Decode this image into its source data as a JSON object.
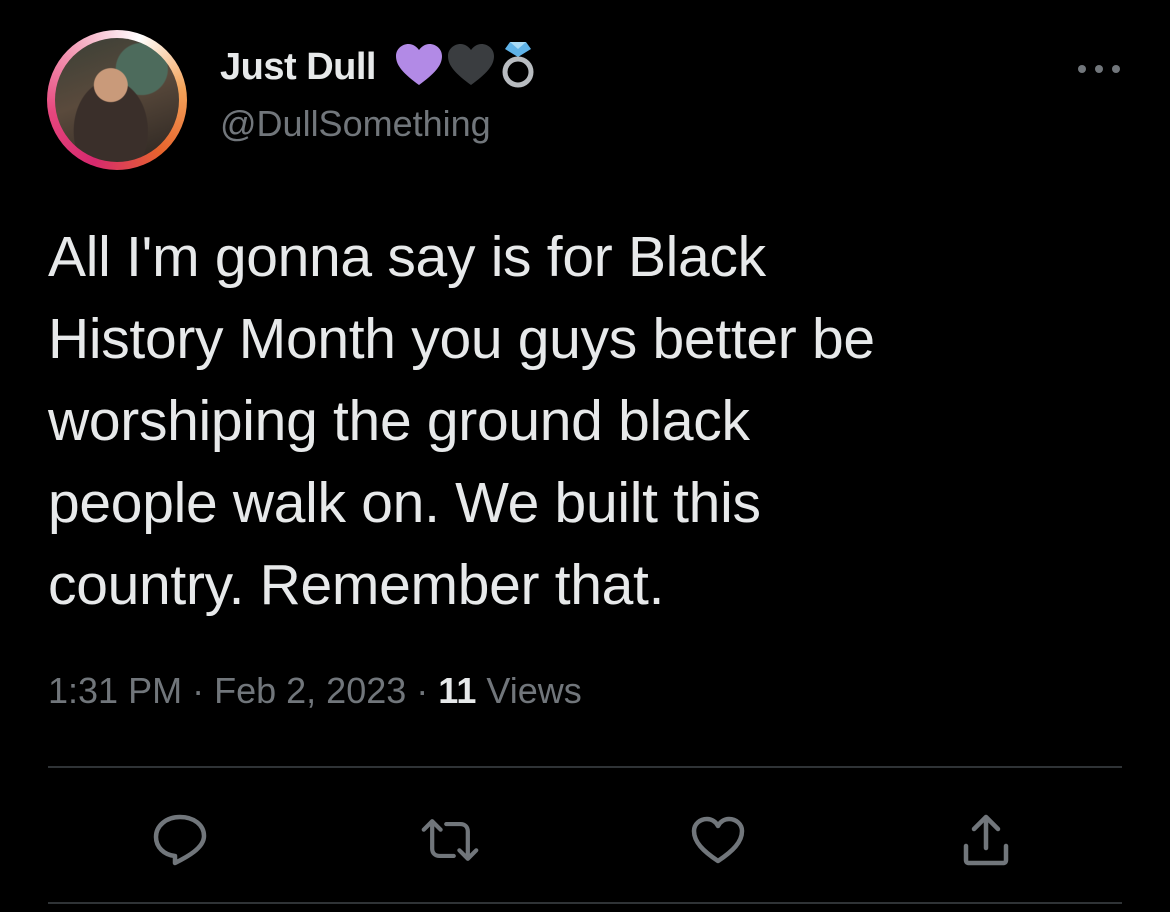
{
  "user": {
    "display_name": "Just Dull",
    "handle": "@DullSomething",
    "name_emojis": [
      "purple-heart",
      "black-heart",
      "ring"
    ],
    "avatar_ring_colors": [
      "#d6296e",
      "#f3a0b9",
      "#ffffff",
      "#e7642d"
    ]
  },
  "tweet": {
    "text": "All I'm gonna say is for Black\nHistory Month you guys better be\nworshiping the ground black\npeople walk on. We built this\ncountry. Remember that.",
    "time": "1:31 PM",
    "date": "Feb 2, 2023",
    "views_count": "11",
    "views_label": "Views",
    "separator": "·"
  },
  "actions": [
    {
      "name": "reply",
      "icon": "reply-icon"
    },
    {
      "name": "retweet",
      "icon": "retweet-icon"
    },
    {
      "name": "like",
      "icon": "heart-icon"
    },
    {
      "name": "share",
      "icon": "share-icon"
    }
  ],
  "colors": {
    "background": "#000000",
    "primary_text": "#e7e9ea",
    "secondary_text": "#71767b",
    "divider": "#2f3336",
    "purple_heart": "#b28ae6"
  }
}
